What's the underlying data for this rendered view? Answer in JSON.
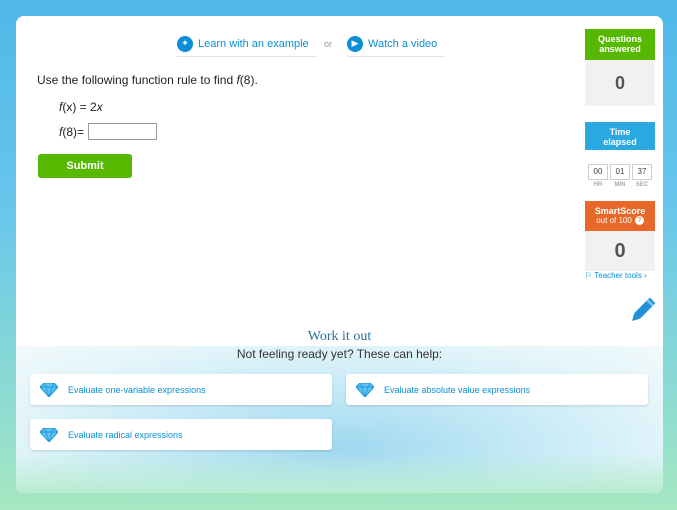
{
  "help": {
    "learn_label": "Learn with an example",
    "or_label": "or",
    "video_label": "Watch a video"
  },
  "question": {
    "prompt_text": "Use the following function rule to find ",
    "prompt_target": "f",
    "prompt_arg": "(8).",
    "rule_f": "f",
    "rule_x": "(x)",
    "rule_eq": " = 2",
    "rule_var": "x",
    "answer_f": "f",
    "answer_arg": "(8)",
    "answer_eq": " =",
    "answer_value": "",
    "submit_label": "Submit"
  },
  "stats": {
    "questions_label_1": "Questions",
    "questions_label_2": "answered",
    "questions_value": "0",
    "time_label_1": "Time",
    "time_label_2": "elapsed",
    "timer": {
      "hr": "00",
      "min": "01",
      "sec": "37",
      "hr_label": "HR",
      "min_label": "MIN",
      "sec_label": "SEC"
    },
    "score_label": "SmartScore",
    "score_sub": "out of 100",
    "score_help": "?",
    "score_value": "0"
  },
  "teacher_tools_label": "Teacher tools ›",
  "work_it_out": {
    "title": "Work it out",
    "subtitle": "Not feeling ready yet? These can help:",
    "skills": [
      "Evaluate one-variable expressions",
      "Evaluate absolute value expressions",
      "Evaluate radical expressions"
    ]
  },
  "colors": {
    "green": "#56b800",
    "blue": "#2aa8e0",
    "orange": "#e8682a",
    "link": "#0a8fd6"
  },
  "icons": {
    "learn": "lightbulb-icon",
    "video": "play-icon",
    "skill": "diamond-icon",
    "pencil": "pencil-icon"
  }
}
